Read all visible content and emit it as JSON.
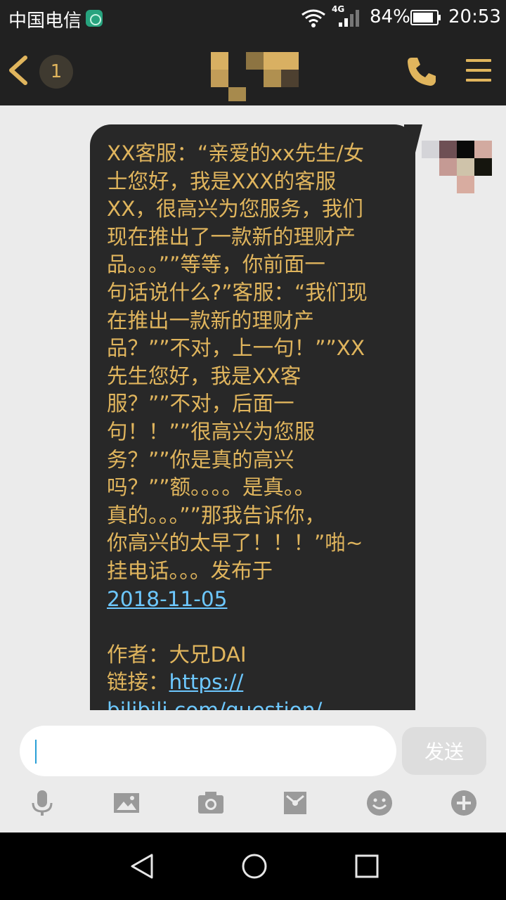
{
  "status_bar": {
    "carrier": "中国电信",
    "network": "4G",
    "battery": "84%",
    "time": "20:53"
  },
  "header": {
    "unread_count": "1"
  },
  "message": {
    "lines": [
      "XX客服：“亲爱的xx先生/女",
      "士您好，我是XXX的客服",
      "XX，很高兴为您服务，我们",
      "现在推出了一款新的理财产",
      "品。。。””等等，你前面一",
      "句话说什么?”客服：“我们现",
      "在推出一款新的理财产",
      "品？””不对，上一句！””XX",
      "先生您好，我是XX客",
      "服？””不对，后面一",
      "句！！””很高兴为您服",
      "务？””你是真的高兴",
      "吗？””额。。。。是真。。",
      "真的。。。””那我告诉你，",
      "你高兴的太早了！！！”啪~",
      "挂电话。。。发布于"
    ],
    "date_link": "2018-11-05",
    "author_line": "作者：大兄DAI",
    "link_label": "链接：",
    "link_text": "https://",
    "link_cut": "bilibili.com/question/"
  },
  "input": {
    "value": "",
    "send_label": "发送"
  },
  "colors": {
    "accent": "#e0b55d",
    "bubble": "#282828",
    "link": "#6dc8ff",
    "bar": "#212121"
  }
}
